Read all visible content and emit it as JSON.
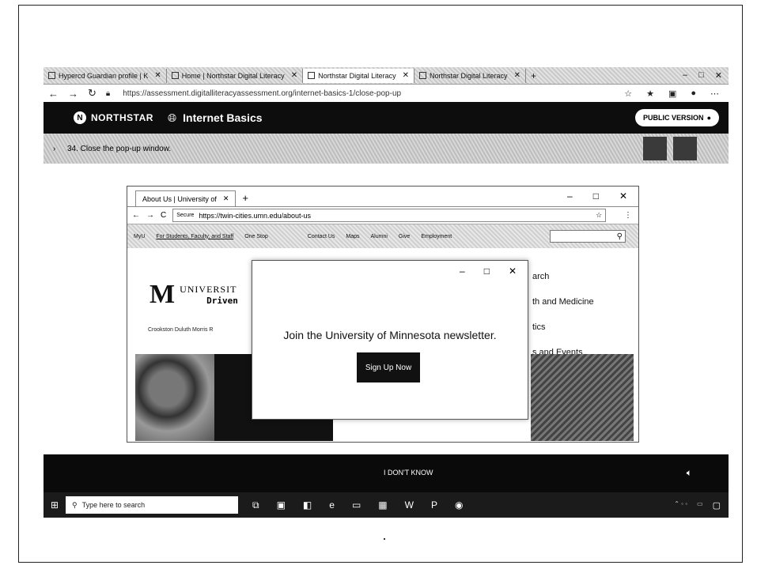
{
  "browser": {
    "tabs": [
      {
        "label": "Hypercd Guardian profile | K"
      },
      {
        "label": "Home | Northstar Digital Literacy"
      },
      {
        "label": "Northstar Digital Literacy"
      },
      {
        "label": "Northstar Digital Literacy"
      }
    ],
    "url": "https://assessment.digitalliteracyassessment.org/internet-basics-1/close-pop-up",
    "nav_back": "←",
    "nav_forward": "→",
    "nav_refresh": "↻",
    "win_min": "–",
    "win_max": "□",
    "win_close": "✕"
  },
  "northstar": {
    "brand": "NORTHSTAR",
    "course": "Internet Basics",
    "public_version": "PUBLIC VERSION"
  },
  "instruction": {
    "step": "34. Close the pop-up window."
  },
  "inner_browser": {
    "tab_label": "About Us | University of",
    "secure": "Secure",
    "url": "https://twin-cities.umn.edu/about-us"
  },
  "umn": {
    "nav": [
      "MyU",
      "For Students, Faculty, and Staff",
      "One Stop",
      "Contact Us",
      "Maps",
      "Alumni",
      "Give",
      "Employment"
    ],
    "name": "UNIVERSIT",
    "tagline": "Driven",
    "campuses": "Crookston  Duluth  Morris  R",
    "side_links": [
      "arch",
      "th and Medicine",
      "tics",
      "s and Events"
    ]
  },
  "popup": {
    "message": "Join the University of Minnesota newsletter.",
    "signup": "Sign Up Now",
    "min": "–",
    "max": "□",
    "close": "✕"
  },
  "footer": {
    "dont_know": "I DON'T KNOW"
  },
  "taskbar": {
    "search_placeholder": "Type here to search"
  }
}
